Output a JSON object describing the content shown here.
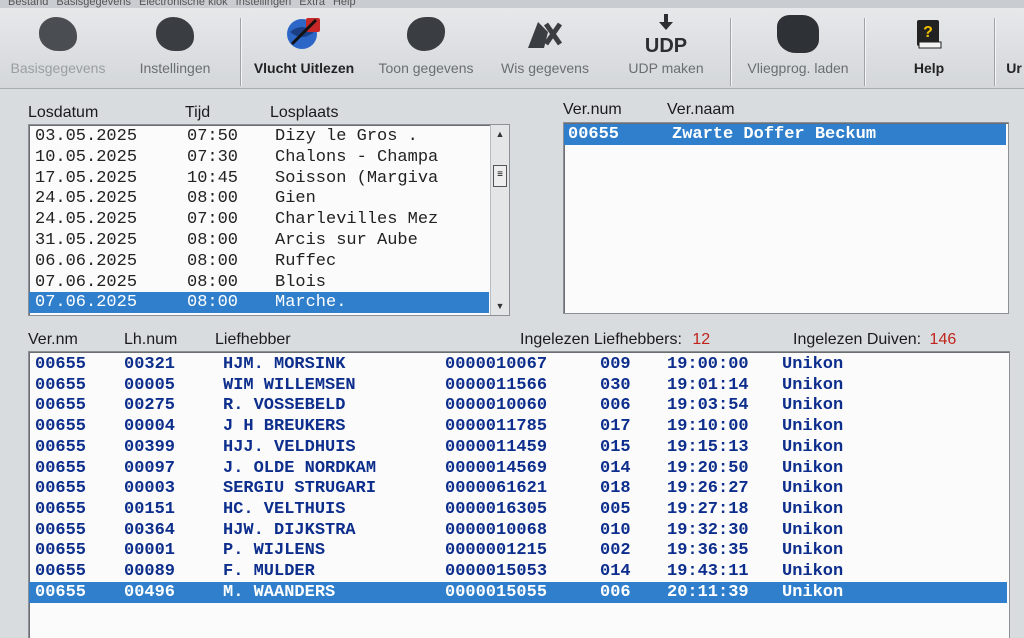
{
  "menu": [
    "Bestand",
    "Basisgegevens",
    "Electronische klok",
    "Instellingen",
    "Extra",
    "Help"
  ],
  "toolbar": [
    {
      "name": "basisgegevens-button",
      "label": "Basisgegevens",
      "icon": "basisgegevens-icon",
      "enabled": false
    },
    {
      "name": "instellingen-button",
      "label": "Instellingen",
      "icon": "instellingen-icon",
      "enabled": true
    },
    {
      "name": "vlucht-uitlezen-button",
      "label": "Vlucht Uitlezen",
      "icon": "vlucht-uitlezen-icon",
      "enabled": true,
      "active": true
    },
    {
      "name": "toon-gegevens-button",
      "label": "Toon gegevens",
      "icon": "toon-gegevens-icon",
      "enabled": true
    },
    {
      "name": "wis-gegevens-button",
      "label": "Wis gegevens",
      "icon": "wis-gegevens-icon",
      "enabled": true
    },
    {
      "name": "udp-maken-button",
      "label": "UDP maken",
      "icon": "udp-icon",
      "enabled": true
    },
    {
      "name": "vliegprog-laden-button",
      "label": "Vliegprog. laden",
      "icon": "vliegprog-icon",
      "enabled": true
    },
    {
      "name": "help-button",
      "label": "Help",
      "icon": "help-book-icon",
      "enabled": true,
      "active": true
    },
    {
      "name": "unikon-button",
      "label": "Ur",
      "icon": "unikon-icon",
      "enabled": true
    }
  ],
  "flights": {
    "headers": {
      "date": "Losdatum",
      "time": "Tijd",
      "place": "Losplaats"
    },
    "rows": [
      {
        "date": "03.05.2025",
        "time": "07:50",
        "place": "Dizy le Gros ."
      },
      {
        "date": "10.05.2025",
        "time": "07:30",
        "place": "Chalons - Champa"
      },
      {
        "date": "17.05.2025",
        "time": "10:45",
        "place": "Soisson (Margiva"
      },
      {
        "date": "24.05.2025",
        "time": "08:00",
        "place": "Gien"
      },
      {
        "date": "24.05.2025",
        "time": "07:00",
        "place": "Charlevilles Mez"
      },
      {
        "date": "31.05.2025",
        "time": "08:00",
        "place": "Arcis sur Aube"
      },
      {
        "date": "06.06.2025",
        "time": "08:00",
        "place": "Ruffec"
      },
      {
        "date": "07.06.2025",
        "time": "08:00",
        "place": "Blois"
      },
      {
        "date": "07.06.2025",
        "time": "08:00",
        "place": "Marche."
      }
    ],
    "selected": 8
  },
  "verenigingen": {
    "headers": {
      "num": "Ver.num",
      "name": "Ver.naam"
    },
    "rows": [
      {
        "num": "00655",
        "name": "Zwarte Doffer Beckum"
      }
    ]
  },
  "liefhebbers": {
    "headers": {
      "vernm": "Ver.nm",
      "lhnum": "Lh.num",
      "name": "Liefhebber"
    },
    "count_label": "Ingelezen Liefhebbers:",
    "count_value": "12",
    "duiven_label": "Ingelezen Duiven:",
    "duiven_value": "146",
    "rows": [
      {
        "vernm": "00655",
        "lhnum": "00321",
        "name": "HJM. MORSINK",
        "code": "0000010067",
        "n": "009",
        "time": "19:00:00",
        "clock": "Unikon"
      },
      {
        "vernm": "00655",
        "lhnum": "00005",
        "name": "WIM WILLEMSEN",
        "code": "0000011566",
        "n": "030",
        "time": "19:01:14",
        "clock": "Unikon"
      },
      {
        "vernm": "00655",
        "lhnum": "00275",
        "name": "R. VOSSEBELD",
        "code": "0000010060",
        "n": "006",
        "time": "19:03:54",
        "clock": "Unikon"
      },
      {
        "vernm": "00655",
        "lhnum": "00004",
        "name": "J H BREUKERS",
        "code": "0000011785",
        "n": "017",
        "time": "19:10:00",
        "clock": "Unikon"
      },
      {
        "vernm": "00655",
        "lhnum": "00399",
        "name": "HJJ. VELDHUIS",
        "code": "0000011459",
        "n": "015",
        "time": "19:15:13",
        "clock": "Unikon"
      },
      {
        "vernm": "00655",
        "lhnum": "00097",
        "name": "J. OLDE NORDKAM",
        "code": "0000014569",
        "n": "014",
        "time": "19:20:50",
        "clock": "Unikon"
      },
      {
        "vernm": "00655",
        "lhnum": "00003",
        "name": "SERGIU STRUGARI",
        "code": "0000061621",
        "n": "018",
        "time": "19:26:27",
        "clock": "Unikon"
      },
      {
        "vernm": "00655",
        "lhnum": "00151",
        "name": "HC. VELTHUIS",
        "code": "0000016305",
        "n": "005",
        "time": "19:27:18",
        "clock": "Unikon"
      },
      {
        "vernm": "00655",
        "lhnum": "00364",
        "name": "HJW. DIJKSTRA",
        "code": "0000010068",
        "n": "010",
        "time": "19:32:30",
        "clock": "Unikon"
      },
      {
        "vernm": "00655",
        "lhnum": "00001",
        "name": "P. WIJLENS",
        "code": "0000001215",
        "n": "002",
        "time": "19:36:35",
        "clock": "Unikon"
      },
      {
        "vernm": "00655",
        "lhnum": "00089",
        "name": "F. MULDER",
        "code": "0000015053",
        "n": "014",
        "time": "19:43:11",
        "clock": "Unikon"
      },
      {
        "vernm": "00655",
        "lhnum": "00496",
        "name": "M. WAANDERS",
        "code": "0000015055",
        "n": "006",
        "time": "20:11:39",
        "clock": "Unikon"
      }
    ],
    "selected": 11
  },
  "colors": {
    "selection": "#2f7fcc",
    "list_text_blue": "#0d2e8c",
    "count_red": "#c0231b"
  }
}
